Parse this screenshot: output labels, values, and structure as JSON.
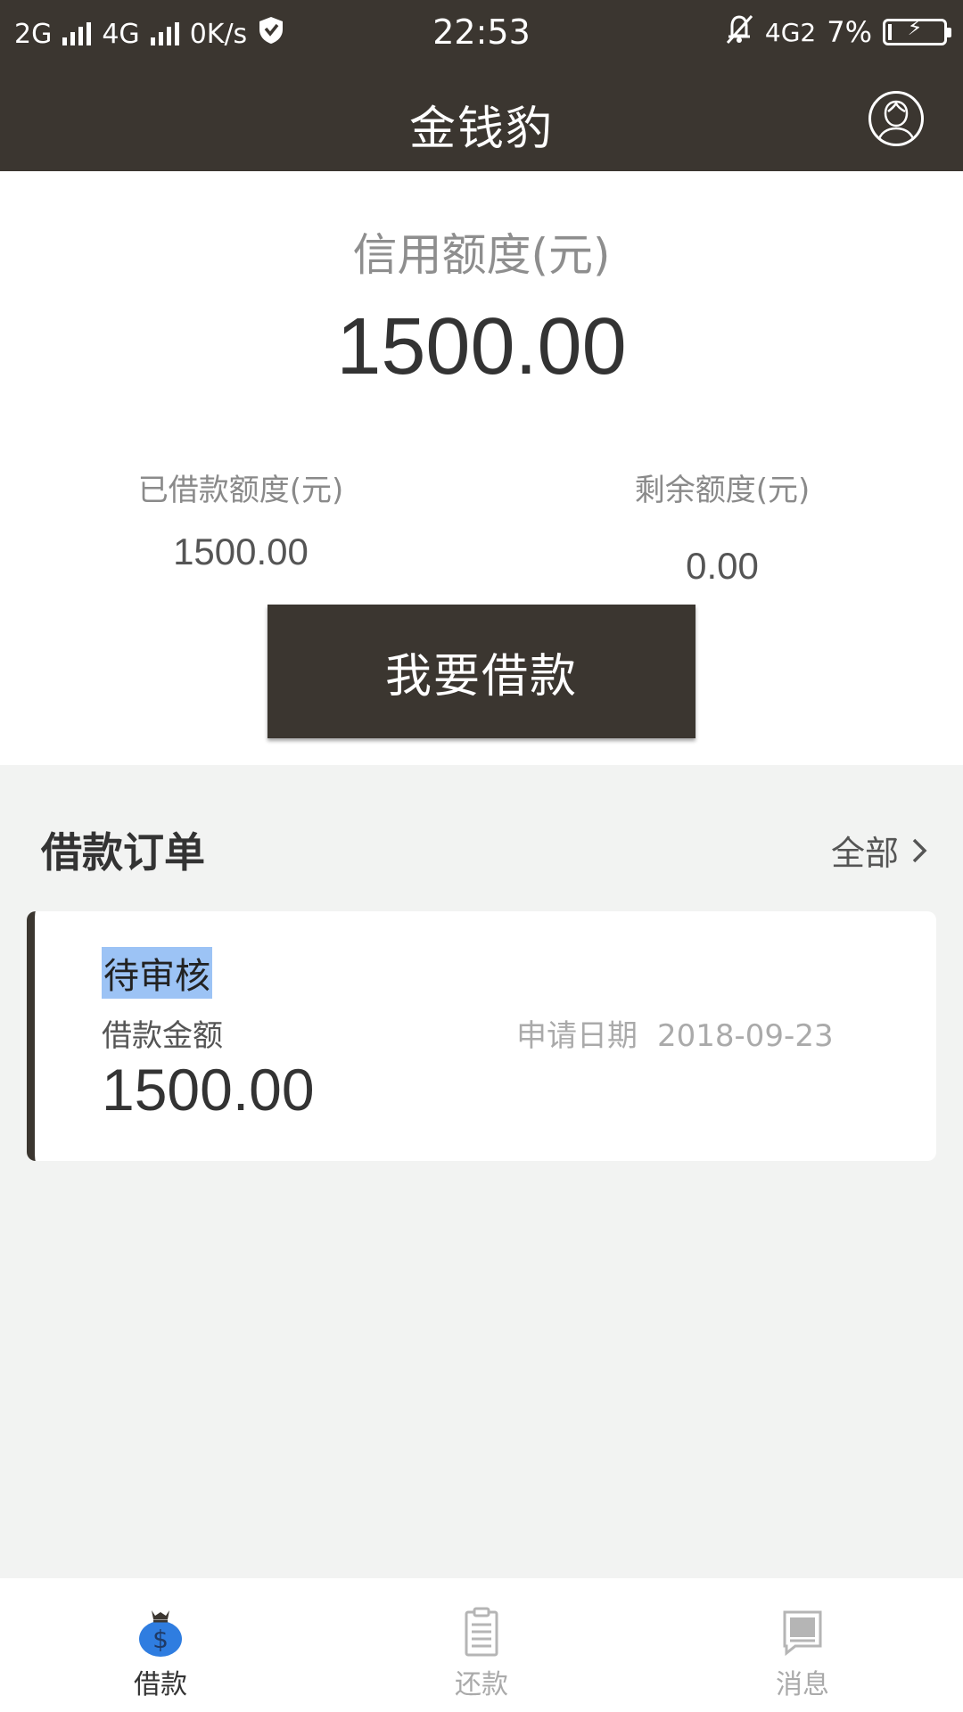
{
  "status_bar": {
    "net1": "2G",
    "net2": "4G",
    "speed": "0K/s",
    "time": "22:53",
    "net3": "4G2",
    "battery": "7%",
    "battery_level": 0.07
  },
  "header": {
    "title": "金钱豹",
    "profile_icon": "user-avatar-icon"
  },
  "credit": {
    "label": "信用额度(元)",
    "value": "1500.00",
    "borrowed_label": "已借款额度(元)",
    "borrowed_value": "1500.00",
    "remaining_label": "剩余额度(元)",
    "remaining_value": "0.00",
    "borrow_button": "我要借款"
  },
  "orders": {
    "title": "借款订单",
    "all_link": "全部",
    "items": [
      {
        "status": "待审核",
        "amount_label": "借款金额",
        "amount": "1500.00",
        "date_label": "申请日期",
        "date": "2018-09-23"
      }
    ]
  },
  "tabbar": {
    "tabs": [
      {
        "label": "借款",
        "icon": "money-bag-icon",
        "active": true
      },
      {
        "label": "还款",
        "icon": "clipboard-icon",
        "active": false
      },
      {
        "label": "消息",
        "icon": "message-icon",
        "active": false
      }
    ]
  },
  "colors": {
    "header_bg": "#3b3630",
    "page_bg": "#f2f3f2",
    "selection_highlight": "#9cc3f5",
    "active_icon": "#2f7de0"
  }
}
